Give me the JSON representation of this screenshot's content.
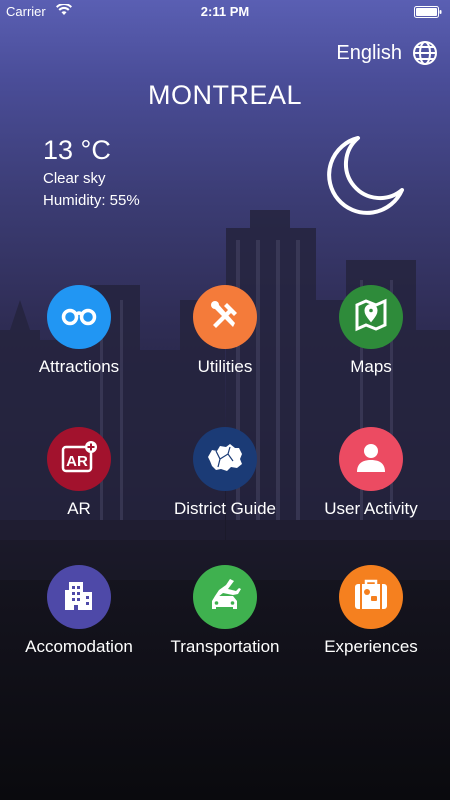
{
  "status_bar": {
    "carrier": "Carrier",
    "time": "2:11 PM"
  },
  "header": {
    "language": "English",
    "city": "MONTREAL"
  },
  "weather": {
    "temperature": "13 °C",
    "condition": "Clear sky",
    "humidity": "Humidity: 55%"
  },
  "menu": [
    {
      "label": "Attractions",
      "icon": "binoculars-icon",
      "color": "#2196f3"
    },
    {
      "label": "Utilities",
      "icon": "tools-icon",
      "color": "#f47b3a"
    },
    {
      "label": "Maps",
      "icon": "map-pin-icon",
      "color": "#2e8b3a"
    },
    {
      "label": "AR",
      "icon": "ar-icon",
      "color": "#a2122d"
    },
    {
      "label": "District Guide",
      "icon": "district-map-icon",
      "color": "#1b3b76"
    },
    {
      "label": "User Activity",
      "icon": "user-icon",
      "color": "#ec4b62"
    },
    {
      "label": "Accomodation",
      "icon": "building-icon",
      "color": "#4e49a8"
    },
    {
      "label": "Transportation",
      "icon": "plane-car-icon",
      "color": "#3fb14f"
    },
    {
      "label": "Experiences",
      "icon": "suitcase-icon",
      "color": "#f5801f"
    }
  ]
}
